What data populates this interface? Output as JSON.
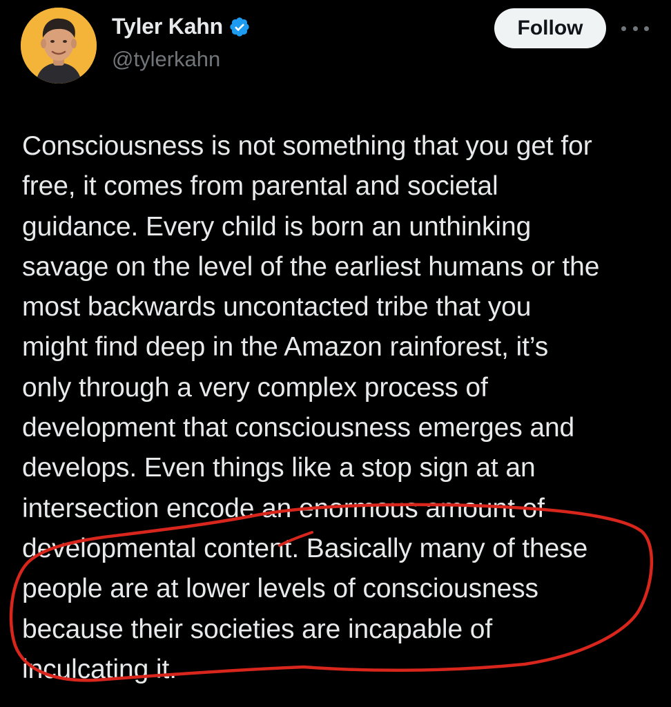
{
  "author": {
    "display_name": "Tyler Kahn",
    "handle": "@tylerkahn",
    "verified": true
  },
  "actions": {
    "follow_label": "Follow",
    "more_icon": "more-horizontal-icon"
  },
  "tweet": {
    "text": "Consciousness is not something that you get for\nfree, it comes from parental and societal\nguidance. Every child is born an unthinking\nsavage on the level of the earliest humans or the\nmost backwards uncontacted tribe that you\nmight find deep in the Amazon rainforest, it’s\nonly through a very complex process of\ndevelopment that consciousness emerges and\ndevelops. Even things like a stop sign at an\nintersection encode an enormous amount of\ndevelopmental content. Basically many of these\npeople are at lower levels of consciousness\nbecause their societies are incapable of\ninculcating it."
  },
  "colors": {
    "background": "#000000",
    "text_primary": "#e7e9ea",
    "text_secondary": "#71767b",
    "follow_bg": "#eff3f4",
    "verified_blue": "#1d9bf0",
    "annotation_red": "#d8261c",
    "avatar_bg": "#f4b43a"
  }
}
